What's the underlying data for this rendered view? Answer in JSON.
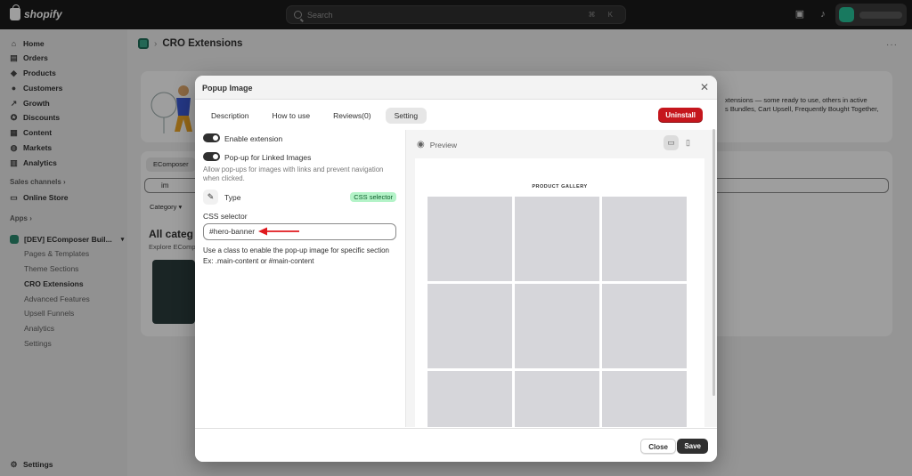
{
  "topbar": {
    "brand": "shopify",
    "search_placeholder": "Search",
    "shortcut": "⌘ K"
  },
  "sidebar": {
    "items": [
      {
        "label": "Home",
        "icon": "home-icon"
      },
      {
        "label": "Orders",
        "icon": "orders-icon"
      },
      {
        "label": "Products",
        "icon": "products-icon"
      },
      {
        "label": "Customers",
        "icon": "customers-icon"
      },
      {
        "label": "Growth",
        "icon": "growth-icon"
      },
      {
        "label": "Discounts",
        "icon": "discounts-icon"
      },
      {
        "label": "Content",
        "icon": "content-icon"
      },
      {
        "label": "Markets",
        "icon": "markets-icon"
      },
      {
        "label": "Analytics",
        "icon": "analytics-icon"
      }
    ],
    "sales_channels_label": "Sales channels",
    "online_store": "Online Store",
    "apps_label": "Apps",
    "app_name": "[DEV] EComposer Buil...",
    "app_subitems": [
      "Pages & Templates",
      "Theme Sections",
      "CRO Extensions",
      "Advanced Features",
      "Upsell Funnels",
      "Analytics",
      "Settings"
    ],
    "settings": "Settings"
  },
  "page": {
    "title": "CRO Extensions",
    "bg_banner_text_1": "xtensions — some ready to use, others in active",
    "bg_banner_text_2": "s Bundles, Cart Upsell, Frequently Bought Together,",
    "bg_tab": "EComposer",
    "bg_search_value": "im",
    "bg_filter": "Category",
    "bg_heading": "All categ",
    "bg_sub": "Explore ECompo"
  },
  "modal": {
    "title": "Popup Image",
    "tabs": [
      "Description",
      "How to use",
      "Reviews(0)",
      "Setting"
    ],
    "active_tab": "Setting",
    "uninstall_label": "Uninstall",
    "enable_extension_label": "Enable extension",
    "enable_extension_on": true,
    "linked_images_label": "Pop-up for Linked Images",
    "linked_images_on": true,
    "linked_images_help": "Allow pop-ups for images with links and prevent navigation when clicked.",
    "type_label": "Type",
    "type_value": "CSS selector",
    "css_selector_label": "CSS selector",
    "css_selector_value": "#hero-banner",
    "css_help_1": "Use a class to enable the pop-up image for specific section",
    "css_help_2": "Ex: .main-content or #main-content",
    "preview_label": "Preview",
    "gallery_title": "PRODUCT GALLERY",
    "close_label": "Close",
    "save_label": "Save"
  },
  "colors": {
    "uninstall": "#c5161d",
    "css_badge_bg": "#b4f3c8",
    "arrow": "#e0191e"
  }
}
